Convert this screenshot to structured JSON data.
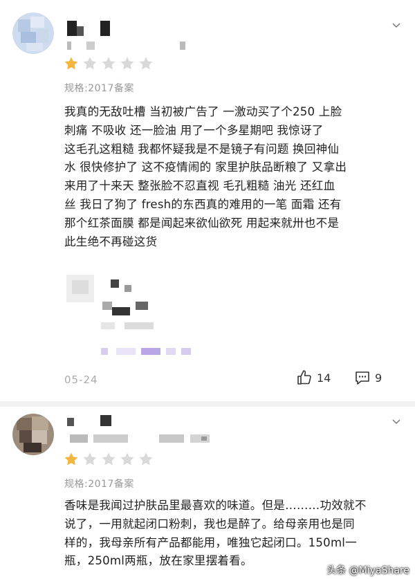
{
  "reviews": [
    {
      "rating": 1,
      "max_rating": 5,
      "spec": "规格:2017备案",
      "text": "我真的无敌吐槽  当初被广告了  一激动买了个250    上脸\n刺痛   不吸收  还一脸油   用了一个多星期吧   我惊讶了\n这毛孔这粗糙   我都怀疑我是不是镜子有问题   换回神仙\n水  很快修护了  这不疫情闹的  家里护肤品断粮了   又拿出\n来用了十来天    整张脸不忍直视    毛孔粗糙  油光  还红血\n丝    我日了狗了  fresh的东西真的难用的一笔    面霜   还有\n那个红茶面膜  都是闻起来欲仙欲死   用起来就卅也不是\n此生绝不再碰这货",
      "date": "05-24",
      "likes": "14",
      "comments": "9"
    },
    {
      "rating": 1,
      "max_rating": 5,
      "spec": "规格:2017备案",
      "text": "香味是我闻过护肤品里最喜欢的味道。但是………功效就不\n说了，一用就起闭口粉刺，我也是醉了。给母亲用也是同\n样的，我母亲所有产品都能用，唯独它起闭口。150ml一\n瓶，250ml两瓶，放在家里摆着看。"
    }
  ],
  "watermark": "头条 @MiyaShare",
  "colors": {
    "star_filled": "#f4b63f",
    "star_empty": "#d9d9d9",
    "spec_text": "#999999",
    "body_text": "#222222",
    "icon": "#333333",
    "divider": "#f2f2f2"
  },
  "icons": [
    "chevron-down-icon",
    "thumbs-up-icon",
    "comment-icon",
    "star-icon"
  ]
}
